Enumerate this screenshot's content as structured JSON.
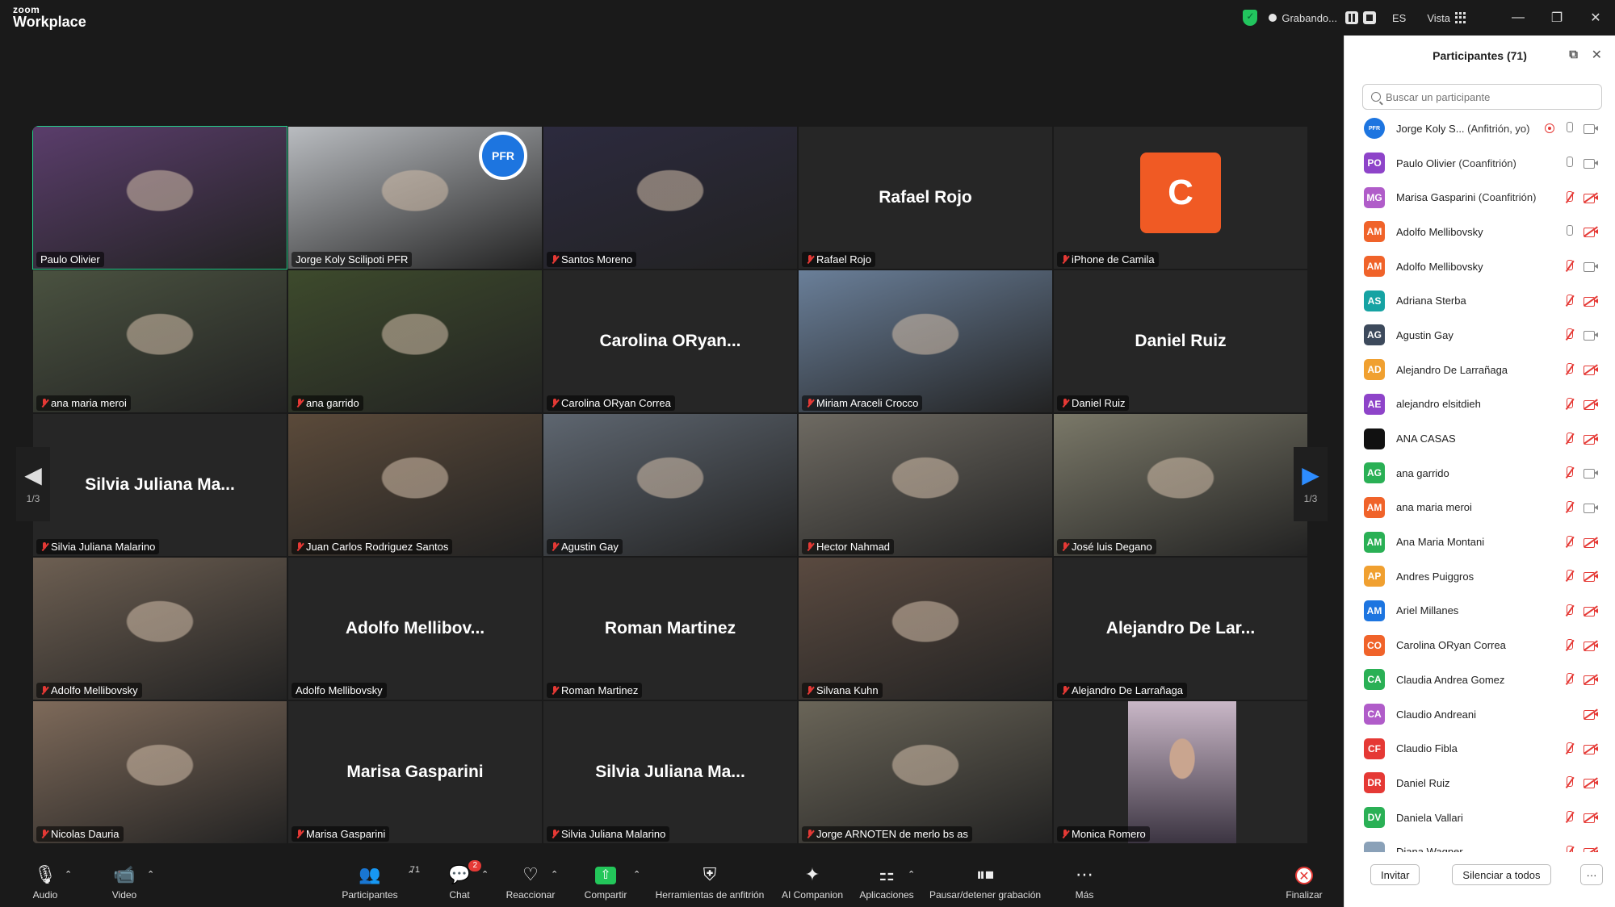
{
  "app": {
    "logo_top": "zoom",
    "logo_bottom": "Workplace"
  },
  "titlebar": {
    "recording_label": "Grabando...",
    "language": "ES",
    "view_label": "Vista"
  },
  "gallery": {
    "page_indicator_left": "1/3",
    "page_indicator_right": "1/3",
    "tiles": [
      {
        "label": "Paulo Olivier",
        "big": "",
        "muted": false,
        "video": true,
        "active": true,
        "bg": "#5a3d6b"
      },
      {
        "label": "Jorge Koly Scilipoti PFR",
        "big": "",
        "muted": false,
        "video": true,
        "bg": "#b9bcc0",
        "pfr": "PFR"
      },
      {
        "label": "Santos Moreno",
        "big": "",
        "muted": true,
        "video": true,
        "bg": "#2c2a3e"
      },
      {
        "label": "Rafael Rojo",
        "big": "Rafael Rojo",
        "muted": true,
        "video": false
      },
      {
        "label": "iPhone de Camila",
        "big": "",
        "muted": true,
        "video": false,
        "avatar": "C"
      },
      {
        "label": "ana maria meroi",
        "big": "",
        "muted": true,
        "video": true,
        "bg": "#4a5240"
      },
      {
        "label": "ana garrido",
        "big": "",
        "muted": true,
        "video": true,
        "bg": "#3d4a2c"
      },
      {
        "label": "Carolina ORyan Correa",
        "big": "Carolina  ORyan...",
        "muted": true,
        "video": false
      },
      {
        "label": "Miriam Araceli Crocco",
        "big": "",
        "muted": true,
        "video": true,
        "bg": "#6a7f99"
      },
      {
        "label": "Daniel Ruiz",
        "big": "Daniel Ruiz",
        "muted": true,
        "video": false
      },
      {
        "label": "Silvia Juliana Malarino",
        "big": "Silvia Juliana Ma...",
        "muted": true,
        "video": false
      },
      {
        "label": "Juan Carlos Rodriguez Santos",
        "big": "",
        "muted": true,
        "video": true,
        "bg": "#5b4a3a"
      },
      {
        "label": "Agustin Gay",
        "big": "",
        "muted": true,
        "video": true,
        "bg": "#5e6670"
      },
      {
        "label": "Hector Nahmad",
        "big": "",
        "muted": true,
        "video": true,
        "bg": "#6e6a62"
      },
      {
        "label": "José luis Degano",
        "big": "",
        "muted": true,
        "video": true,
        "bg": "#7a7868"
      },
      {
        "label": "Adolfo Mellibovsky",
        "big": "",
        "muted": true,
        "video": true,
        "bg": "#6d5f52"
      },
      {
        "label": "Adolfo Mellibovsky",
        "big": "Adolfo  Mellibov...",
        "muted": false,
        "video": false
      },
      {
        "label": "Roman Martinez",
        "big": "Roman Martinez",
        "muted": true,
        "video": false
      },
      {
        "label": "Silvana Kuhn",
        "big": "",
        "muted": true,
        "video": true,
        "bg": "#5a4a40"
      },
      {
        "label": "Alejandro De Larrañaga",
        "big": "Alejandro De Lar...",
        "muted": true,
        "video": false
      },
      {
        "label": "Nicolas Dauria",
        "big": "",
        "muted": true,
        "video": true,
        "bg": "#7e6a5a"
      },
      {
        "label": "Marisa Gasparini",
        "big": "Marisa Gasparini",
        "muted": true,
        "video": false
      },
      {
        "label": "Silvia Juliana Malarino",
        "big": "Silvia Juliana Ma...",
        "muted": true,
        "video": false
      },
      {
        "label": "Jorge ARNOTEN de merlo bs as",
        "big": "",
        "muted": true,
        "video": true,
        "bg": "#6a6558"
      },
      {
        "label": "Monica Romero",
        "big": "",
        "muted": true,
        "video": true,
        "bg": "#c9b7c7",
        "portrait": true
      }
    ]
  },
  "toolbar": {
    "audio": "Audio",
    "video": "Video",
    "participants": "Participantes",
    "participants_count": "71",
    "chat": "Chat",
    "chat_badge": "2",
    "react": "Reaccionar",
    "share": "Compartir",
    "host_tools": "Herramientas de anfitrión",
    "ai_companion": "AI Companion",
    "apps": "Aplicaciones",
    "pause_record": "Pausar/detener grabación",
    "more": "Más",
    "end": "Finalizar"
  },
  "panel": {
    "title": "Participantes (71)",
    "search_placeholder": "Buscar un participante",
    "invite": "Invitar",
    "mute_all": "Silenciar a todos",
    "more": "···",
    "participants": [
      {
        "initials": "",
        "name": "Jorge Koly S...",
        "role": "(Anfitrión, yo)",
        "color": "#1d75e0",
        "mic": "on",
        "cam": "on",
        "rec": true,
        "pfr": true
      },
      {
        "initials": "PO",
        "name": "Paulo Olivier",
        "role": "(Coanfitrión)",
        "color": "#8e44c9",
        "mic": "on",
        "cam": "on"
      },
      {
        "initials": "MG",
        "name": "Marisa Gasparini",
        "role": "(Coanfitrión)",
        "color": "#b05cc9",
        "mic": "off",
        "cam": "off"
      },
      {
        "initials": "AM",
        "name": "Adolfo Mellibovsky",
        "role": "",
        "color": "#f0632a",
        "mic": "on",
        "cam": "off"
      },
      {
        "initials": "AM",
        "name": "Adolfo Mellibovsky",
        "role": "",
        "color": "#f0632a",
        "mic": "off",
        "cam": "on"
      },
      {
        "initials": "AS",
        "name": "Adriana Sterba",
        "role": "",
        "color": "#16a3a3",
        "mic": "off",
        "cam": "off"
      },
      {
        "initials": "AG",
        "name": "Agustin Gay",
        "role": "",
        "color": "#3d4a5c",
        "mic": "off",
        "cam": "on"
      },
      {
        "initials": "AD",
        "name": "Alejandro De Larrañaga",
        "role": "",
        "color": "#f0a030",
        "mic": "off",
        "cam": "off"
      },
      {
        "initials": "AE",
        "name": "alejandro elsitdieh",
        "role": "",
        "color": "#8e44c9",
        "mic": "off",
        "cam": "off"
      },
      {
        "initials": "",
        "name": "ANA CASAS",
        "role": "",
        "color": "#111111",
        "mic": "off",
        "cam": "off"
      },
      {
        "initials": "AG",
        "name": "ana garrido",
        "role": "",
        "color": "#2ab055",
        "mic": "off",
        "cam": "on"
      },
      {
        "initials": "AM",
        "name": "ana maria meroi",
        "role": "",
        "color": "#f0632a",
        "mic": "off",
        "cam": "on"
      },
      {
        "initials": "AM",
        "name": "Ana Maria Montani",
        "role": "",
        "color": "#2ab055",
        "mic": "off",
        "cam": "off"
      },
      {
        "initials": "AP",
        "name": "Andres Puiggros",
        "role": "",
        "color": "#f0a030",
        "mic": "off",
        "cam": "off"
      },
      {
        "initials": "AM",
        "name": "Ariel Millanes",
        "role": "",
        "color": "#1d75e0",
        "mic": "off",
        "cam": "off"
      },
      {
        "initials": "CO",
        "name": "Carolina ORyan Correa",
        "role": "",
        "color": "#f0632a",
        "mic": "off",
        "cam": "off"
      },
      {
        "initials": "CA",
        "name": "Claudia Andrea Gomez",
        "role": "",
        "color": "#2ab055",
        "mic": "off",
        "cam": "off"
      },
      {
        "initials": "CA",
        "name": "Claudio Andreani",
        "role": "",
        "color": "#b05cc9",
        "mic": "none",
        "cam": "off"
      },
      {
        "initials": "CF",
        "name": "Claudio Fibla",
        "role": "",
        "color": "#e53935",
        "mic": "off",
        "cam": "off"
      },
      {
        "initials": "DR",
        "name": "Daniel Ruiz",
        "role": "",
        "color": "#e53935",
        "mic": "off",
        "cam": "off"
      },
      {
        "initials": "DV",
        "name": "Daniela Vallari",
        "role": "",
        "color": "#2ab055",
        "mic": "off",
        "cam": "off"
      },
      {
        "initials": "",
        "name": "Diana Wagner",
        "role": "",
        "color": "#8aa1b8",
        "mic": "off",
        "cam": "off"
      }
    ]
  }
}
